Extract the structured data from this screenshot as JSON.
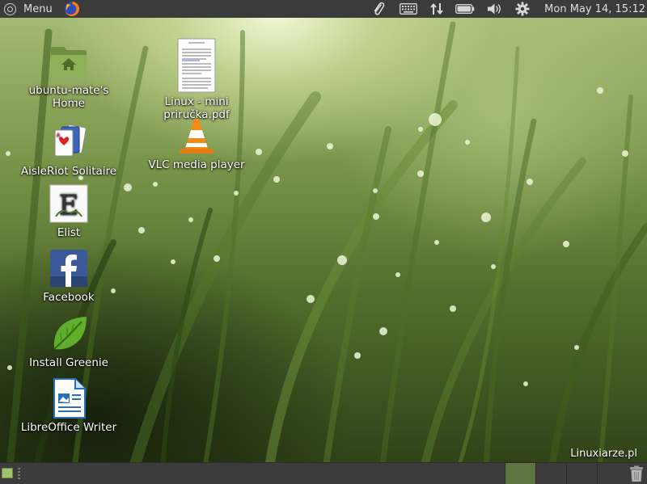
{
  "top_panel": {
    "menu_label": "Menu",
    "menu_icon": "ubuntu-logo-icon",
    "launcher_icon": "firefox-icon",
    "tray_icons": [
      "paperclip-icon",
      "keyboard-icon",
      "network-icon",
      "battery-icon",
      "volume-icon",
      "gear-icon"
    ],
    "clock": "Mon May 14, 15:12"
  },
  "desktop": {
    "icons": [
      {
        "id": "home",
        "label": "ubuntu-mate's\nHome",
        "icon": "home-folder-icon"
      },
      {
        "id": "solitaire",
        "label": "AisleRiot Solitaire",
        "icon": "playing-cards-icon"
      },
      {
        "id": "elist",
        "label": "Elist",
        "icon": "elist-icon"
      },
      {
        "id": "facebook",
        "label": "Facebook",
        "icon": "facebook-icon"
      },
      {
        "id": "greenie",
        "label": "Install Greenie",
        "icon": "green-leaf-icon"
      },
      {
        "id": "writer",
        "label": "LibreOffice Writer",
        "icon": "libreoffice-writer-icon"
      },
      {
        "id": "pdf",
        "label": "Linux - mini\npriručka.pdf",
        "icon": "pdf-document-icon"
      },
      {
        "id": "vlc",
        "label": "VLC media player",
        "icon": "vlc-cone-icon"
      }
    ],
    "watermark": "Linuxiarze.pl"
  },
  "bottom_panel": {
    "show_desktop_icon": "show-desktop-icon",
    "workspaces": 4,
    "active_workspace": 1,
    "trash_icon": "trash-icon"
  },
  "colors": {
    "panel": "#3b3b3b",
    "panel_text": "#dfdfdf",
    "active_workspace": "#5f7541",
    "folder_green": "#87a556"
  }
}
